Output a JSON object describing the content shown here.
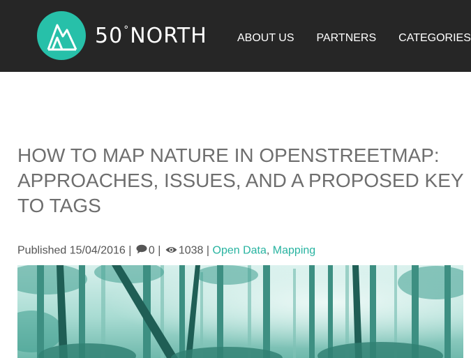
{
  "brand": {
    "name_prefix": "50",
    "degree": "°",
    "name_suffix": "NORTH",
    "accent_color": "#27c0a9"
  },
  "nav": {
    "items": [
      {
        "label": "ABOUT US"
      },
      {
        "label": "PARTNERS"
      },
      {
        "label": "CATEGORIES"
      }
    ]
  },
  "article": {
    "title": "HOW TO MAP NATURE IN OPENSTREETMAP: APPROACHES, ISSUES, AND A PROPOSED KEY TO TAGS",
    "published_label": "Published",
    "published_date": "15/04/2016",
    "separator": "|",
    "comments_count": "0",
    "comments_icon": "comment-bubble-icon",
    "views_count": "1038",
    "views_icon": "eye-icon",
    "categories": [
      {
        "label": "Open Data"
      },
      {
        "label": "Mapping"
      }
    ],
    "category_delimiter": ",",
    "image_subject": "forest-photo",
    "link_color": "#27b3a0"
  }
}
